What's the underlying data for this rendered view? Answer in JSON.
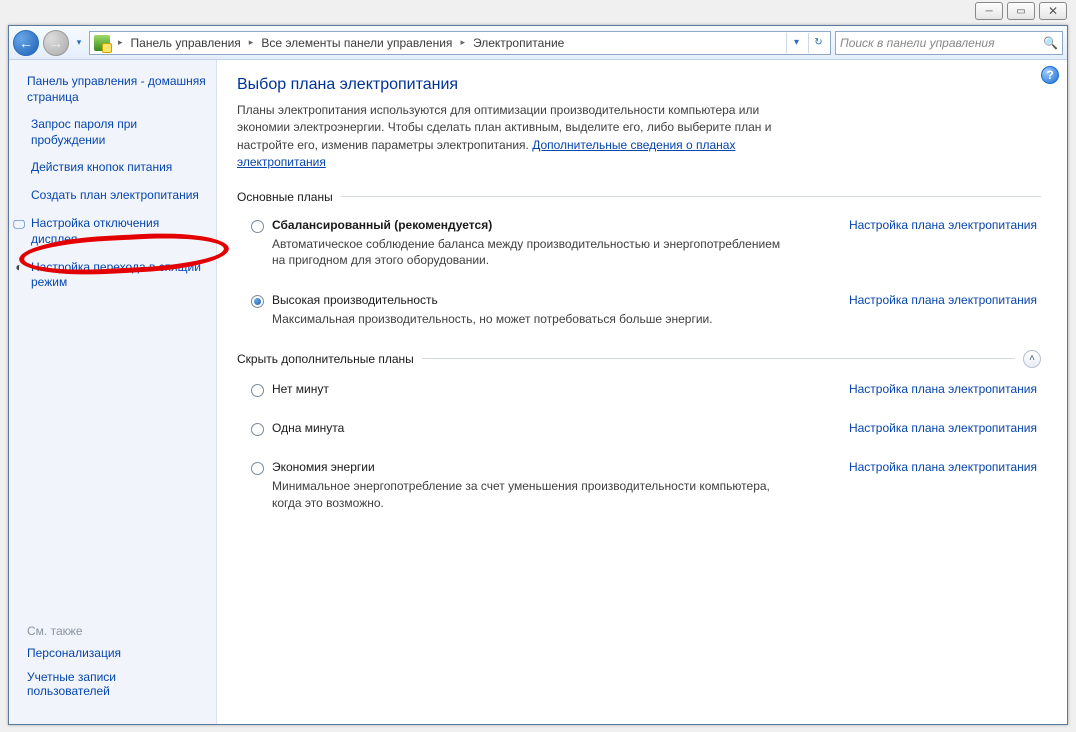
{
  "chrome": {
    "min": "─",
    "max": "▭",
    "close": "✕"
  },
  "nav": {
    "back_glyph": "←",
    "fwd_glyph": "→",
    "drop_glyph": "▾",
    "refresh_glyph": "↻"
  },
  "breadcrumb": {
    "items": [
      "Панель управления",
      "Все элементы панели управления",
      "Электропитание"
    ],
    "sep": "▸"
  },
  "search": {
    "placeholder": "Поиск в панели управления",
    "icon": "🔍"
  },
  "help_glyph": "?",
  "sidebar": {
    "home": "Панель управления - домашняя страница",
    "links": [
      {
        "label": "Запрос пароля при пробуждении",
        "icon": ""
      },
      {
        "label": "Действия кнопок питания",
        "icon": ""
      },
      {
        "label": "Создать план электропитания",
        "icon": ""
      },
      {
        "label": "Настройка отключения дисплея",
        "icon": "🖵"
      },
      {
        "label": "Настройка перехода в спящий режим",
        "icon": "◐"
      }
    ],
    "see_also_hdr": "См. также",
    "see_also": [
      "Персонализация",
      "Учетные записи пользователей"
    ]
  },
  "content": {
    "title": "Выбор плана электропитания",
    "desc": "Планы электропитания используются для оптимизации производительности компьютера или экономии электроэнергии. Чтобы сделать план активным, выделите его, либо выберите план и настройте его, изменив параметры электропитания. ",
    "desc_link": "Дополнительные сведения о планах электропитания",
    "section1": "Основные планы",
    "section2": "Скрыть дополнительные планы",
    "collapse_glyph": "˄",
    "settings_link": "Настройка плана электропитания",
    "plans_main": [
      {
        "name": "Сбалансированный (рекомендуется)",
        "bold": true,
        "checked": false,
        "desc": "Автоматическое соблюдение баланса между производительностью и энергопотреблением на пригодном для этого оборудовании."
      },
      {
        "name": "Высокая производительность",
        "bold": false,
        "checked": true,
        "desc": "Максимальная производительность, но может потребоваться больше энергии."
      }
    ],
    "plans_extra": [
      {
        "name": "Нет минут",
        "checked": false,
        "desc": ""
      },
      {
        "name": "Одна минута",
        "checked": false,
        "desc": ""
      },
      {
        "name": "Экономия энергии",
        "checked": false,
        "desc": "Минимальное энергопотребление за счет уменьшения производительности компьютера, когда это возможно."
      }
    ]
  }
}
